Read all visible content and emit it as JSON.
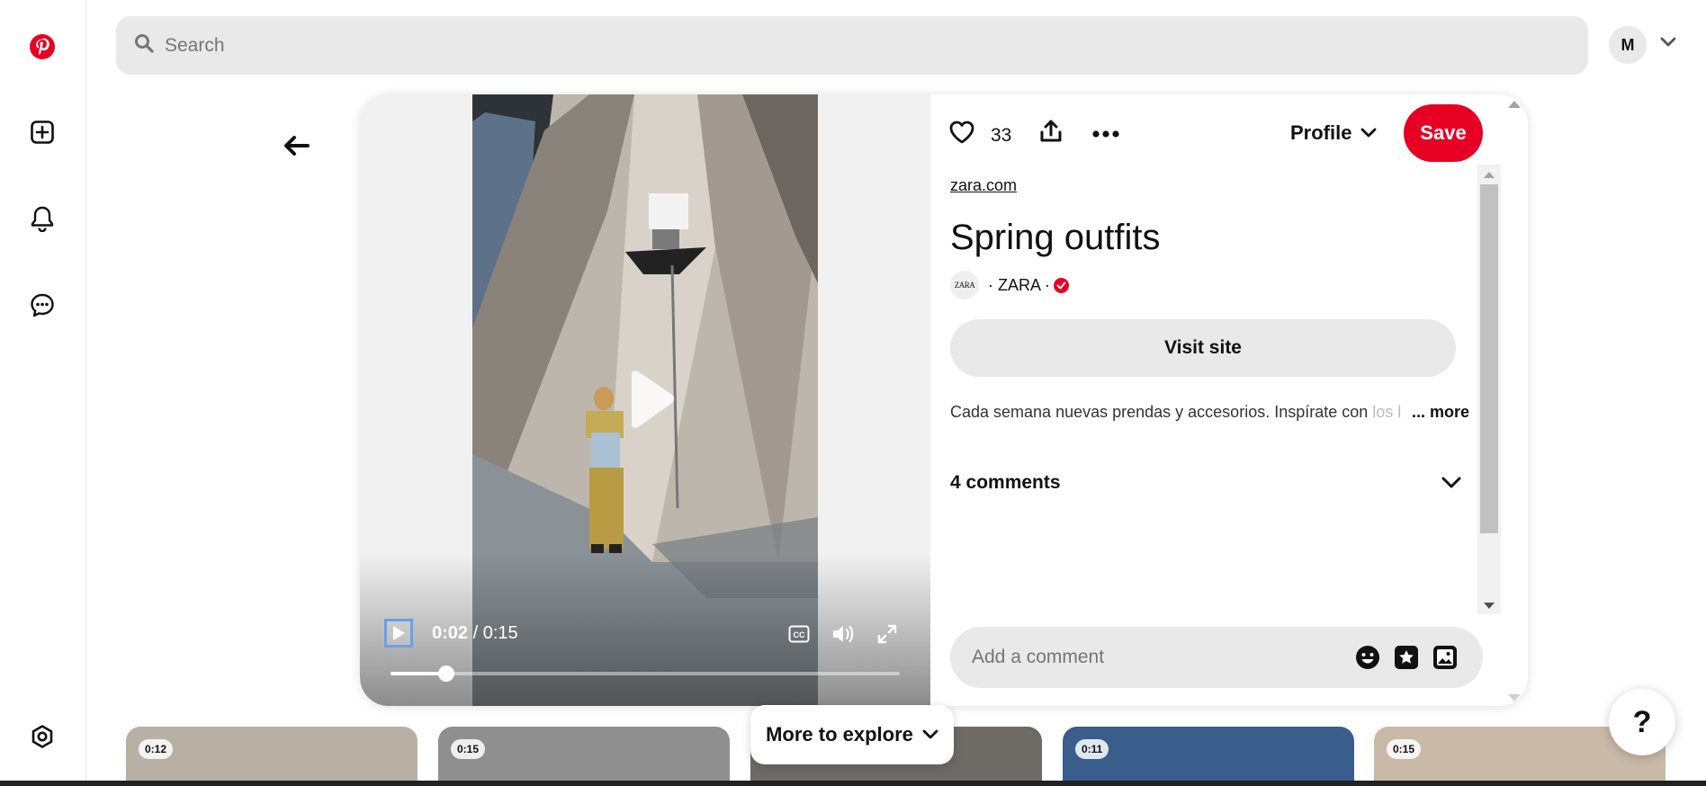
{
  "nav": {
    "items": [
      {
        "name": "pinterest-logo"
      },
      {
        "name": "create-icon"
      },
      {
        "name": "notifications-icon"
      },
      {
        "name": "messages-icon"
      },
      {
        "name": "settings-icon"
      }
    ],
    "brand_color": "#e60023"
  },
  "header": {
    "search_placeholder": "Search",
    "avatar_initial": "M"
  },
  "pin": {
    "like_count": "33",
    "profile_label": "Profile",
    "save_label": "Save",
    "source": "zara.com",
    "title": "Spring outfits",
    "creator_logo": "ZARA",
    "creator": "· ZARA ·",
    "visit_label": "Visit site",
    "description": "Cada semana nuevas prendas y accesorios. Inspírate con",
    "description_faded": "los l",
    "more_label": "... more",
    "comments_label": "4 comments",
    "comment_placeholder": "Add a comment"
  },
  "video": {
    "current_time": "0:02",
    "separator": " / ",
    "duration": "0:15",
    "progress_fraction": 0.11
  },
  "more_to_explore": {
    "label": "More to explore",
    "thumbnails": [
      {
        "duration": "0:12",
        "color": "#b8b0a4"
      },
      {
        "duration": "0:15",
        "color": "#8f8f8f"
      },
      {
        "duration": "",
        "color": "#6e6a66"
      },
      {
        "duration": "0:11",
        "color": "#3a5e8c"
      },
      {
        "duration": "0:15",
        "color": "#c9b9a7"
      }
    ]
  },
  "help_label": "?"
}
